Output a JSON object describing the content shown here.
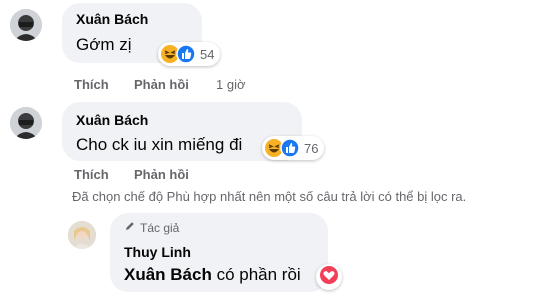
{
  "comments": [
    {
      "author": "Xuân Bách",
      "text": "Gớm zị",
      "reaction_count": "54",
      "reactions": [
        "haha-icon",
        "like-icon"
      ],
      "actions": {
        "like": "Thích",
        "reply": "Phản hồi",
        "time": "1 giờ"
      }
    },
    {
      "author": "Xuân Bách",
      "text": "Cho ck iu xin miếng đi",
      "reaction_count": "76",
      "reactions": [
        "haha-icon",
        "like-icon"
      ],
      "actions": {
        "like": "Thích",
        "reply": "Phản hồi"
      }
    }
  ],
  "filter_note": "Đã chọn chế độ Phù hợp nhất nên một số câu trả lời có thể bị lọc ra.",
  "reply": {
    "badge": "Tác giả",
    "author": "Thuy Linh",
    "mention": "Xuân Bách",
    "text": " có phần rồi",
    "reaction": "love-icon"
  },
  "colors": {
    "bubble": "#f0f2f5",
    "secondary_text": "#65676b",
    "like_blue": "#1877f2",
    "haha_yellow": "#f7b125",
    "love_red": "#f33e58"
  }
}
